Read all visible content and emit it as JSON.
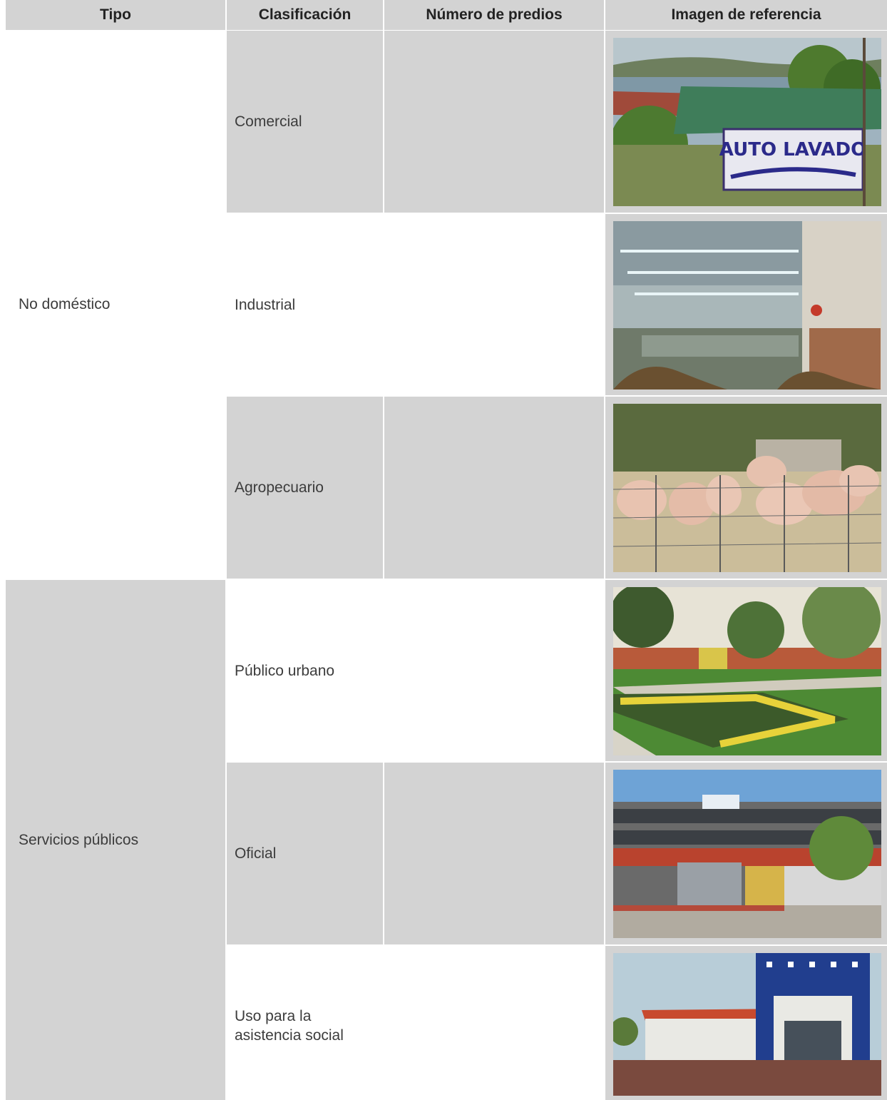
{
  "table": {
    "headers": {
      "tipo": "Tipo",
      "clasificacion": "Clasificación",
      "numero": "Número de predios",
      "imagen": "Imagen de referencia"
    },
    "groups": [
      {
        "tipo": "No doméstico"
      },
      {
        "tipo": "Servicios públicos"
      }
    ],
    "rows": [
      {
        "clasificacion": "Comercial",
        "numero": "",
        "photo": "car-wash-photo",
        "sign_text": "AUTO LAVADO"
      },
      {
        "clasificacion": "Industrial",
        "numero": "",
        "photo": "factory-interior-photo"
      },
      {
        "clasificacion": "Agropecuario",
        "numero": "",
        "photo": "pigs-pen-photo"
      },
      {
        "clasificacion": "Público urbano",
        "numero": "",
        "photo": "urban-park-photo"
      },
      {
        "clasificacion": "Oficial",
        "numero": "",
        "photo": "government-building-photo"
      },
      {
        "clasificacion": "Uso para la asistencia social",
        "numero": "",
        "photo": "health-center-photo"
      }
    ]
  }
}
